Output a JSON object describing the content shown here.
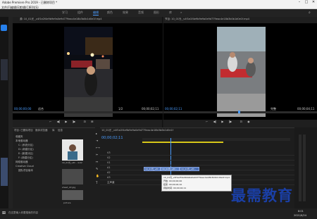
{
  "window": {
    "title": "Adobe Premiere Pro 2019 - 已删除项目 *",
    "menu": [
      "文件(F)",
      "编辑(E)",
      "剪辑(C)",
      "序列(S)",
      "标记(M)",
      "图形(G)",
      "视图(V)",
      "窗口(W)",
      "帮助(H)"
    ]
  },
  "workspaces": [
    "学习",
    "组件",
    "编辑",
    "颜色",
    "效果",
    "音频",
    "图形",
    "库",
    "»"
  ],
  "source_monitor": {
    "header": "源: 10_01光 _v4f1e2f4e9b9e9a0e9d779eac4e18b3b0b1d0e1f.mp4",
    "timecode_left": "00;00;00;00",
    "fit_label": "适合",
    "page": "1/2",
    "timecode_right": "00;00;02;11"
  },
  "program_monitor": {
    "header": "节目: 10_01光 _v4f1e2f4e9b9e9a0e9d779eac4e18b3b0b1d0e1f.mp4",
    "timecode_left": "00;00;02;11",
    "fit_label": "完整",
    "timecode_right": "00;00;04;11"
  },
  "project_panel": {
    "tabs": [
      "项目: 已删除项目",
      "媒体浏览器",
      "库",
      "信息"
    ],
    "tree": [
      "收藏夹",
      "本地驱动器",
      "C: (系统分区)",
      "D: (新建分区)",
      "E: (新建分区)",
      "F: (新建分区)",
      "网络驱动器",
      "Creative Cloud",
      "团队项目版本"
    ],
    "thumbs": [
      {
        "name": "10_01光_v4f...",
        "duration": "4;02"
      },
      {
        "name": "sheet_22.jpg",
        "duration": ""
      },
      {
        "name": "picture",
        "duration": ""
      }
    ]
  },
  "timeline": {
    "header": "10_01光 _v4f1e2f4e9b9e9a0e9d779eac4e18b3b0b1d0e1f",
    "timecode": "00;00;02;11",
    "tracks": [
      "V3",
      "V2",
      "V1",
      "A1",
      "A2",
      "A3",
      "主声道"
    ],
    "clips": [
      {
        "label": "10_01光_v4f..."
      },
      {
        "label": "10_01光_v4f..."
      },
      {
        "label": "10_01光_v4f..."
      }
    ],
    "tooltip": {
      "line1": "10_01光_v4f1e2f4e9b9e9a0e9d779eac4e18b3b0b1d0e1f.mp4",
      "line2": "开始: 00;00;00;00",
      "line3": "结束: 00;00;04;10",
      "line4": "持续时间: 00;00;04;11"
    }
  },
  "taskbar": {
    "search": "在这里输入你要搜索的内容",
    "time": "8:01",
    "date": "2021/6/24"
  },
  "watermark": "最需教育"
}
